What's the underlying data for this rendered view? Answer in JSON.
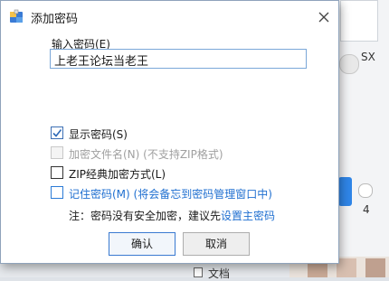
{
  "dialog": {
    "title": "添加密码",
    "password_label": "输入密码(E)",
    "password_value": "上老王论坛当老王",
    "options": [
      {
        "label": "显示密码(S)",
        "checked": true,
        "enabled": true
      },
      {
        "label": "加密文件名(N) (不支持ZIP格式)",
        "checked": false,
        "enabled": false
      },
      {
        "label": "ZIP经典加密方式(L)",
        "checked": false,
        "enabled": true
      },
      {
        "label": "记住密码(M) (将会备忘到密码管理窗口中)",
        "checked": false,
        "enabled": true
      }
    ],
    "note_prefix": "注：密码没有安全加密，建议先",
    "note_link": "设置主密码",
    "ok_label": "确认",
    "cancel_label": "取消"
  },
  "background": {
    "label_sx": "SX",
    "label_4": "4",
    "label_wen": "文档",
    "left_fragments": [
      "智",
      "压",
      "智"
    ]
  }
}
